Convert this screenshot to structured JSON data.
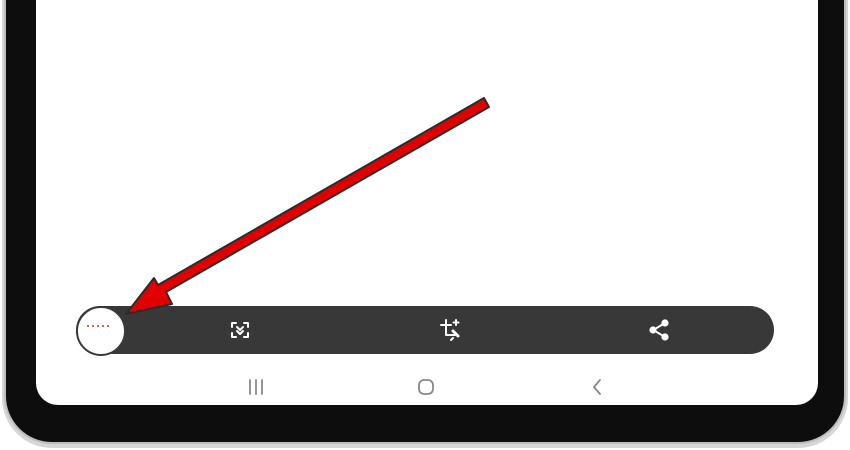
{
  "toolbar": {
    "thumbnail_icon": "screenshot-thumbnail",
    "buttons": [
      {
        "icon": "scroll-capture-icon"
      },
      {
        "icon": "crop-edit-icon"
      },
      {
        "icon": "share-icon"
      }
    ]
  },
  "nav": {
    "buttons": [
      {
        "icon": "recents-icon"
      },
      {
        "icon": "home-icon"
      },
      {
        "icon": "back-icon"
      }
    ]
  },
  "colors": {
    "toolbar_bg": "#383838",
    "arrow": "#e00000",
    "device_frame": "#0d0d0d",
    "screen": "#ffffff"
  }
}
